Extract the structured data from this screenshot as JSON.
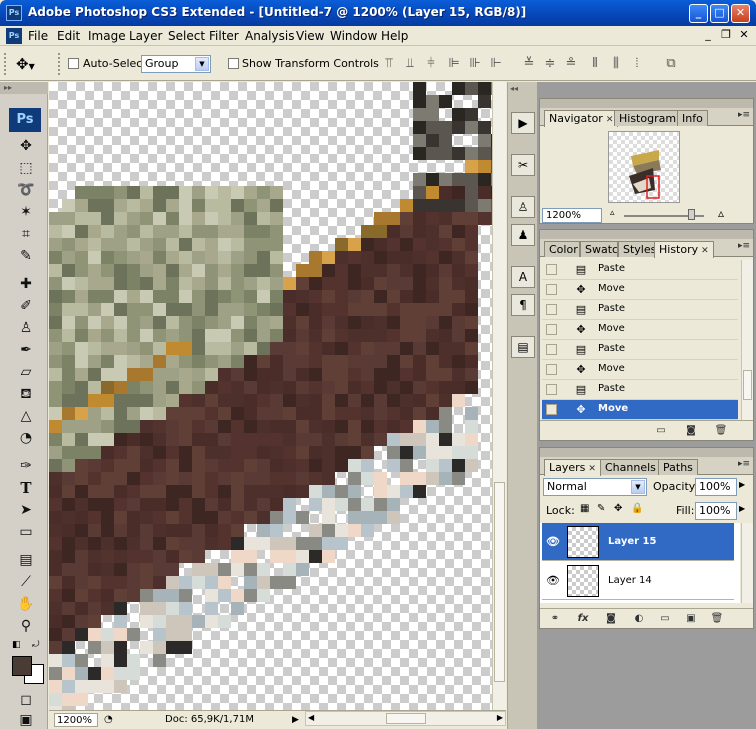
{
  "window": {
    "app_icon": "Ps",
    "title": "Adobe Photoshop CS3 Extended - [Untitled-7 @ 1200% (Layer 15, RGB/8)]",
    "buttons": {
      "minimize": "_",
      "maximize": "□",
      "close": "✕"
    }
  },
  "menubar": {
    "doc_icon": "Ps",
    "items": [
      "File",
      "Edit",
      "Image",
      "Layer",
      "Select",
      "Filter",
      "Analysis",
      "View",
      "Window",
      "Help"
    ],
    "doc_buttons": {
      "minimize": "_",
      "restore": "❐",
      "close": "✕"
    }
  },
  "options": {
    "tool_icon": "move-tool-icon",
    "auto_select_label": "Auto-Select:",
    "auto_select_value": "Group",
    "show_transform_label": "Show Transform Controls"
  },
  "toolbox": {
    "logo": "Ps",
    "foreground_color": "#4a3c34",
    "background_color": "#ffffff"
  },
  "status": {
    "zoom": "1200%",
    "doc_info": "Doc: 65,9K/1,71M"
  },
  "navigator": {
    "tabs": [
      "Navigator",
      "Histogram",
      "Info"
    ],
    "zoom": "1200%"
  },
  "history": {
    "tabs": [
      "Color",
      "Swatc",
      "Styles",
      "History"
    ],
    "rows": [
      {
        "label": "Paste",
        "icon": "paste-icon"
      },
      {
        "label": "Move",
        "icon": "move-icon"
      },
      {
        "label": "Paste",
        "icon": "paste-icon"
      },
      {
        "label": "Move",
        "icon": "move-icon"
      },
      {
        "label": "Paste",
        "icon": "paste-icon"
      },
      {
        "label": "Move",
        "icon": "move-icon"
      },
      {
        "label": "Paste",
        "icon": "paste-icon"
      },
      {
        "label": "Move",
        "icon": "move-icon",
        "selected": true
      }
    ]
  },
  "layers": {
    "tabs": [
      "Layers",
      "Channels",
      "Paths"
    ],
    "blend_mode": "Normal",
    "opacity_label": "Opacity:",
    "opacity": "100%",
    "lock_label": "Lock:",
    "fill_label": "Fill:",
    "fill": "100%",
    "rows": [
      {
        "name": "Layer 15",
        "selected": true
      },
      {
        "name": "Layer 14",
        "selected": false
      }
    ]
  },
  "colors": {
    "selection": "#316ac5",
    "title_blue": "#0646b8"
  }
}
